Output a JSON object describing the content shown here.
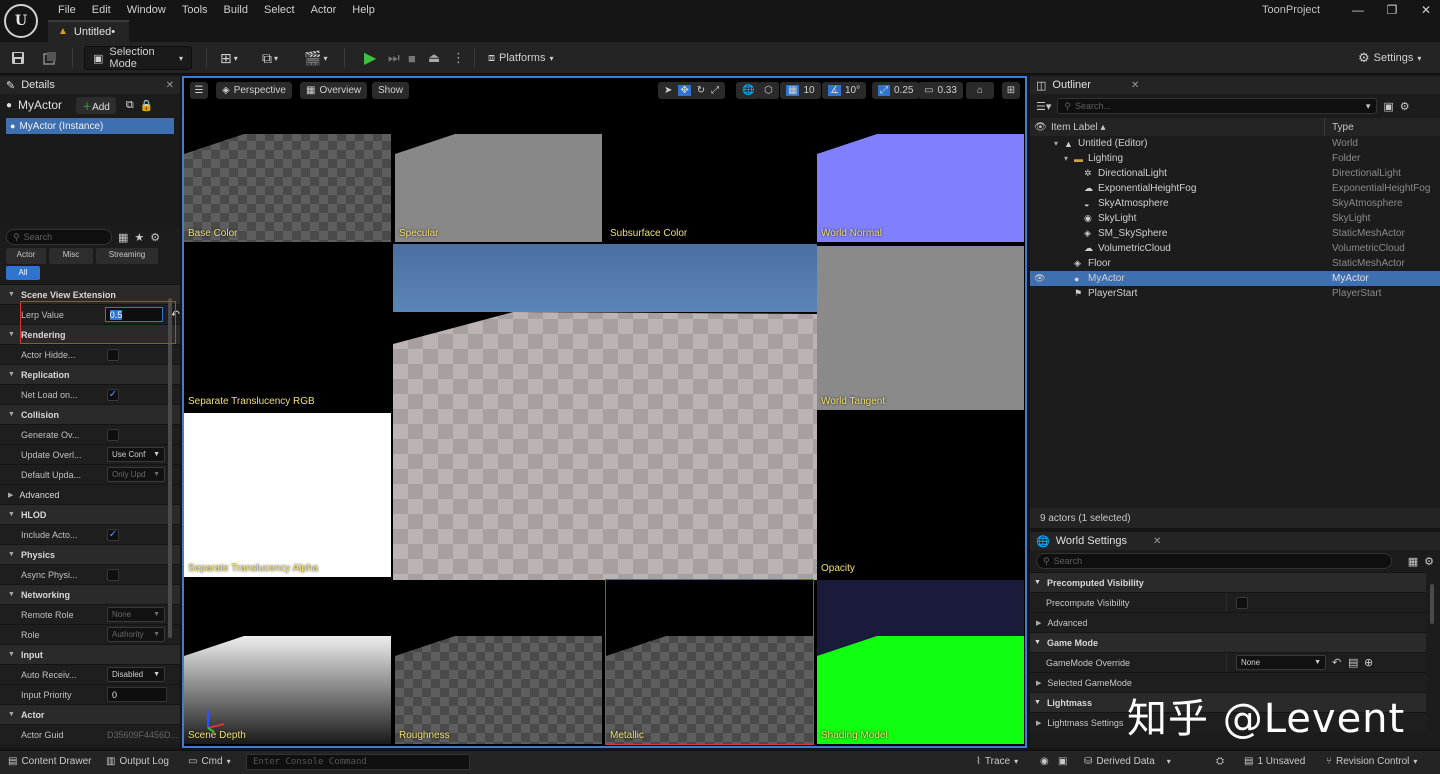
{
  "menubar": {
    "logo_letter": "U",
    "items": [
      "File",
      "Edit",
      "Window",
      "Tools",
      "Build",
      "Select",
      "Actor",
      "Help"
    ],
    "doc_tab": "Untitled•",
    "project_name": "ToonProject",
    "window_controls": [
      "—",
      "❐",
      "✕"
    ]
  },
  "toolbar": {
    "selection_mode": "Selection Mode",
    "platforms": "Platforms",
    "settings": "Settings"
  },
  "details": {
    "tab_title": "Details",
    "actor_name": "MyActor",
    "add_label": "Add",
    "instance_label": "MyActor (Instance)",
    "search_placeholder": "Search",
    "filter_tabs": [
      "Actor",
      "Misc",
      "Streaming",
      "All"
    ],
    "sections": [
      {
        "title": "Scene View Extension",
        "rows": [
          {
            "name": "Lerp Value",
            "kind": "input",
            "value": "0.5"
          }
        ]
      },
      {
        "title": "Rendering",
        "rows": [
          {
            "name": "Actor Hidde...",
            "kind": "check",
            "checked": false
          }
        ]
      },
      {
        "title": "Replication",
        "rows": [
          {
            "name": "Net Load on...",
            "kind": "check",
            "checked": true
          }
        ]
      },
      {
        "title": "Collision",
        "rows": [
          {
            "name": "Generate Ov...",
            "kind": "check",
            "checked": false
          },
          {
            "name": "Update Overl...",
            "kind": "dropdown",
            "value": "Use Conf",
            "dim": false
          },
          {
            "name": "Default Upda...",
            "kind": "dropdown",
            "value": "Only Upd",
            "dim": true
          }
        ]
      },
      {
        "title": "Advanced",
        "collapsed": true,
        "rows": []
      },
      {
        "title": "HLOD",
        "rows": [
          {
            "name": "Include Acto...",
            "kind": "check",
            "checked": true
          }
        ]
      },
      {
        "title": "Physics",
        "rows": [
          {
            "name": "Async Physi...",
            "kind": "check",
            "checked": false
          }
        ]
      },
      {
        "title": "Networking",
        "rows": [
          {
            "name": "Remote Role",
            "kind": "dropdown",
            "value": "None",
            "dim": true
          },
          {
            "name": "Role",
            "kind": "dropdown",
            "value": "Authority",
            "dim": true
          }
        ]
      },
      {
        "title": "Input",
        "rows": [
          {
            "name": "Auto Receiv...",
            "kind": "dropdown",
            "value": "Disabled",
            "dim": false
          },
          {
            "name": "Input Priority",
            "kind": "input",
            "value": "0"
          }
        ]
      },
      {
        "title": "Actor",
        "rows": [
          {
            "name": "Actor Guid",
            "kind": "text",
            "value": "D35609F4456D..."
          }
        ]
      }
    ]
  },
  "viewport": {
    "toolbar_left": [
      "Perspective",
      "Overview",
      "Show"
    ],
    "toolbar_right": {
      "grid_size": "10",
      "angle": "10°",
      "scale": "0.25",
      "camera_speed": "0.33"
    },
    "tiles": [
      {
        "label": "Base Color"
      },
      {
        "label": "Specular"
      },
      {
        "label": "Subsurface Color"
      },
      {
        "label": "World Normal"
      },
      {
        "label": "Separate Translucency RGB"
      },
      {
        "label": "World Tangent"
      },
      {
        "label": "Separate Translucency Alpha"
      },
      {
        "label": "Opacity"
      },
      {
        "label": "Scene Depth"
      },
      {
        "label": "Roughness"
      },
      {
        "label": "Metallic"
      },
      {
        "label": "Shading Model"
      }
    ]
  },
  "outliner": {
    "tab_title": "Outliner",
    "search_placeholder": "Search...",
    "col_label": "Item Label",
    "col_type": "Type",
    "rows": [
      {
        "label": "Untitled (Editor)",
        "type": "World",
        "indent": 1,
        "arrow": "▾",
        "icon": "▲"
      },
      {
        "label": "Lighting",
        "type": "Folder",
        "indent": 2,
        "arrow": "▾",
        "icon": "▬"
      },
      {
        "label": "DirectionalLight",
        "type": "DirectionalLight",
        "indent": 3,
        "icon": "✲"
      },
      {
        "label": "ExponentialHeightFog",
        "type": "ExponentialHeightFog",
        "indent": 3,
        "icon": "☁"
      },
      {
        "label": "SkyAtmosphere",
        "type": "SkyAtmosphere",
        "indent": 3,
        "icon": "◒"
      },
      {
        "label": "SkyLight",
        "type": "SkyLight",
        "indent": 3,
        "icon": "◉"
      },
      {
        "label": "SM_SkySphere",
        "type": "StaticMeshActor",
        "indent": 3,
        "icon": "◈"
      },
      {
        "label": "VolumetricCloud",
        "type": "VolumetricCloud",
        "indent": 3,
        "icon": "☁"
      },
      {
        "label": "Floor",
        "type": "StaticMeshActor",
        "indent": 2,
        "icon": "◈"
      },
      {
        "label": "MyActor",
        "type": "MyActor",
        "indent": 2,
        "icon": "●",
        "selected": true
      },
      {
        "label": "PlayerStart",
        "type": "PlayerStart",
        "indent": 2,
        "icon": "⚑"
      }
    ],
    "footer": "9 actors (1 selected)"
  },
  "world_settings": {
    "tab_title": "World Settings",
    "search_placeholder": "Search",
    "rows": [
      {
        "kind": "section",
        "title": "Precomputed Visibility"
      },
      {
        "kind": "prop",
        "name": "Precompute Visibility",
        "control": "check"
      },
      {
        "kind": "subsection",
        "title": "Advanced"
      },
      {
        "kind": "section",
        "title": "Game Mode"
      },
      {
        "kind": "prop",
        "name": "GameMode Override",
        "control": "dropdown",
        "value": "None"
      },
      {
        "kind": "subsection",
        "title": "Selected GameMode"
      },
      {
        "kind": "section",
        "title": "Lightmass"
      },
      {
        "kind": "subsection",
        "title": "Lightmass Settings"
      }
    ]
  },
  "statusbar": {
    "content_drawer": "Content Drawer",
    "output_log": "Output Log",
    "cmd": "Cmd",
    "console_placeholder": "Enter Console Command",
    "trace": "Trace",
    "derived_data": "Derived Data",
    "unsaved": "1 Unsaved",
    "revision_control": "Revision Control"
  },
  "watermark": "知乎 @Levent",
  "colors": {
    "accent": "#3b7dd8",
    "selection": "#3e6fb0",
    "highlight_red": "#e03030",
    "label_yellow": "#f0e070"
  }
}
